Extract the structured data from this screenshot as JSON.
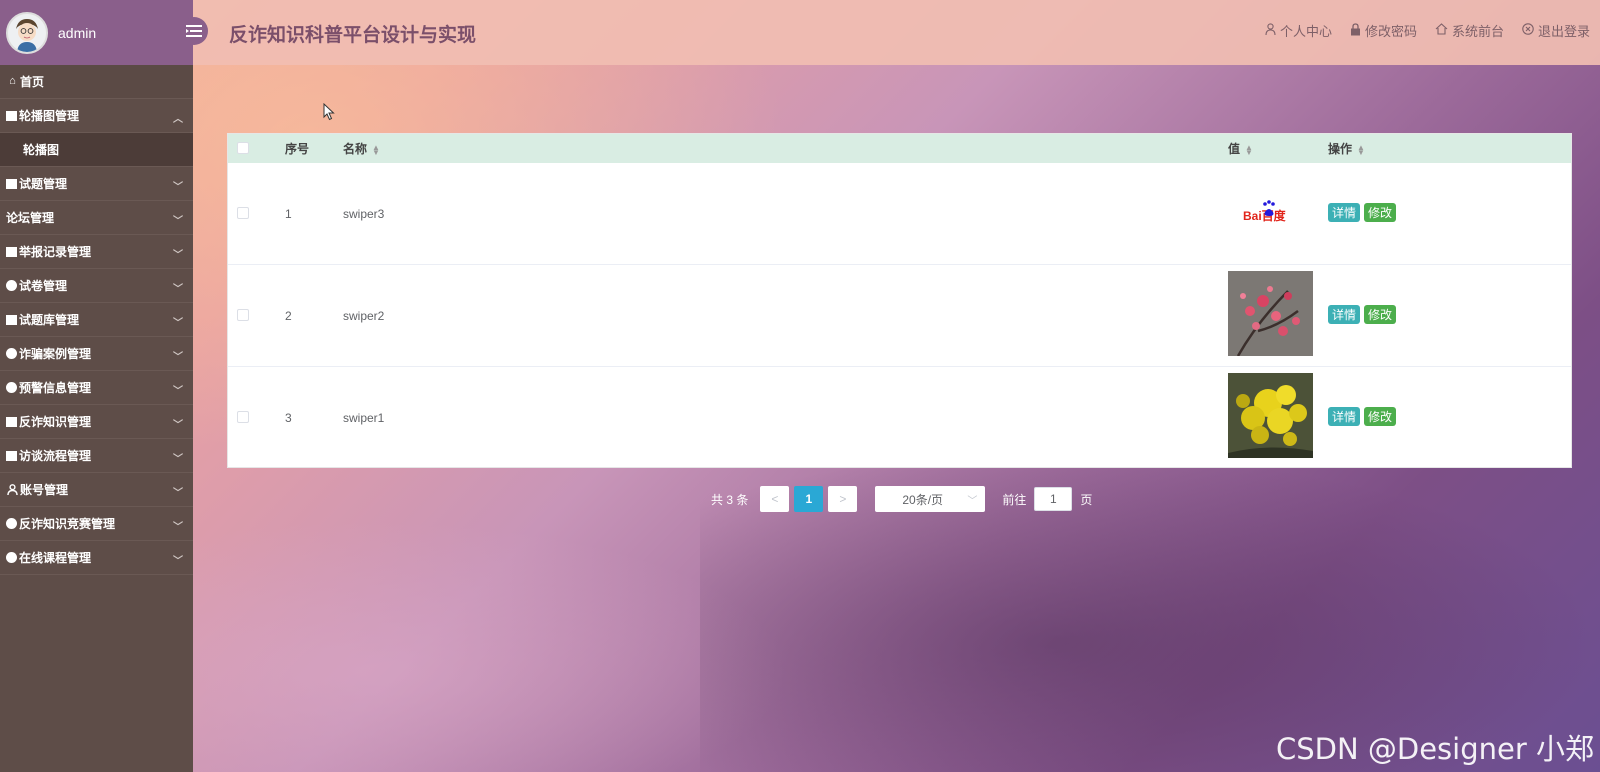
{
  "user": {
    "name": "admin"
  },
  "header": {
    "title": "反诈知识科普平台设计与实现",
    "links": [
      {
        "label": "个人中心",
        "icon": "person-icon"
      },
      {
        "label": "修改密码",
        "icon": "lock-icon"
      },
      {
        "label": "系统前台",
        "icon": "home-icon"
      },
      {
        "label": "退出登录",
        "icon": "close-circle-icon"
      }
    ]
  },
  "sidebar": {
    "home": "首页",
    "items": [
      {
        "label": "轮播图管理",
        "icon": "square",
        "expanded": true,
        "children": [
          "轮播图"
        ]
      },
      {
        "label": "试题管理",
        "icon": "square"
      },
      {
        "label": "论坛管理",
        "icon": "none"
      },
      {
        "label": "举报记录管理",
        "icon": "square"
      },
      {
        "label": "试卷管理",
        "icon": "circle"
      },
      {
        "label": "试题库管理",
        "icon": "square"
      },
      {
        "label": "诈骗案例管理",
        "icon": "circle"
      },
      {
        "label": "预警信息管理",
        "icon": "circle"
      },
      {
        "label": "反诈知识管理",
        "icon": "square"
      },
      {
        "label": "访谈流程管理",
        "icon": "square"
      },
      {
        "label": "账号管理",
        "icon": "person"
      },
      {
        "label": "反诈知识竞赛管理",
        "icon": "circle"
      },
      {
        "label": "在线课程管理",
        "icon": "circle"
      }
    ]
  },
  "table": {
    "columns": {
      "index": "序号",
      "name": "名称",
      "value": "值",
      "action": "操作"
    },
    "rows": [
      {
        "index": "1",
        "name": "swiper3",
        "image": "baidu-logo",
        "logo_text": "Bai百度"
      },
      {
        "index": "2",
        "name": "swiper2",
        "image": "pink-blossom-photo"
      },
      {
        "index": "3",
        "name": "swiper1",
        "image": "yellow-flower-photo"
      }
    ],
    "detail_label": "详情",
    "edit_label": "修改"
  },
  "pagination": {
    "total": "共 3 条",
    "prev": "<",
    "current": "1",
    "next": ">",
    "page_size": "20条/页",
    "goto_label": "前往",
    "goto_value": "1",
    "unit": "页"
  },
  "watermark": "CSDN @Designer 小郑"
}
